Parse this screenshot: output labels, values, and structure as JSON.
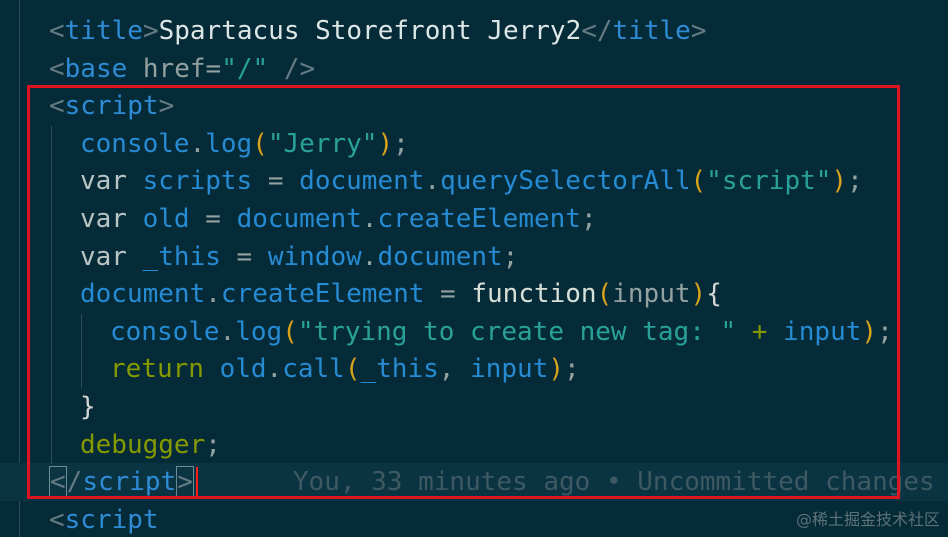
{
  "code": {
    "line1": {
      "lt": "<",
      "tag": "title",
      "gt": ">",
      "text": "Spartacus Storefront Jerry2",
      "close_lt": "</",
      "close_tag": "title",
      "close_gt": ">"
    },
    "line2": {
      "lt": "<",
      "tag": "base",
      "attr": " href=",
      "value": "\"/\"",
      "end": " />"
    },
    "line3": {
      "lt": "<",
      "tag": "script",
      "gt": ">"
    },
    "line4": {
      "obj": "console",
      "dot": ".",
      "method": "log",
      "open": "(",
      "string": "\"Jerry\"",
      "close": ")",
      "semi": ";"
    },
    "line5": {
      "kw": "var",
      "name": " scripts",
      "eq": " = ",
      "obj": "document",
      "dot": ".",
      "method": "querySelectorAll",
      "open": "(",
      "string": "\"script\"",
      "close": ")",
      "semi": ";"
    },
    "line6": {
      "kw": "var",
      "name": " old",
      "eq": " = ",
      "obj": "document",
      "dot": ".",
      "method": "createElement",
      "semi": ";"
    },
    "line7": {
      "kw": "var",
      "name": " _this",
      "eq": " = ",
      "obj": "window",
      "dot": ".",
      "prop": "document",
      "semi": ";"
    },
    "line8": {
      "obj": "document",
      "dot": ".",
      "method": "createElement",
      "eq": " = ",
      "kw": "function",
      "open": "(",
      "param": "input",
      "close": ")",
      "brace": "{"
    },
    "line9": {
      "obj": "console",
      "dot": ".",
      "method": "log",
      "open": "(",
      "string": "\"trying to create new tag: \"",
      "plus": " + ",
      "param": "input",
      "close": ")",
      "semi": ";"
    },
    "line10": {
      "kw": "return",
      "obj": " old",
      "dot": ".",
      "method": "call",
      "open": "(",
      "arg1": "_this",
      "comma": ", ",
      "arg2": "input",
      "close": ")",
      "semi": ";"
    },
    "line11": {
      "brace": "}"
    },
    "line12": {
      "kw": "debugger",
      "semi": ";"
    },
    "line13": {
      "lt": "<",
      "slash": "/",
      "tag": "script",
      "gt": ">",
      "blame": "You, 33 minutes ago • Uncommitted changes"
    },
    "line14": {
      "lt": "<",
      "tag": "script"
    }
  },
  "watermark": "@稀土掘金技术社区",
  "colors": {
    "background": "#052b38",
    "selection_border": "#e0141e",
    "cursor": "#ff1a1a"
  }
}
